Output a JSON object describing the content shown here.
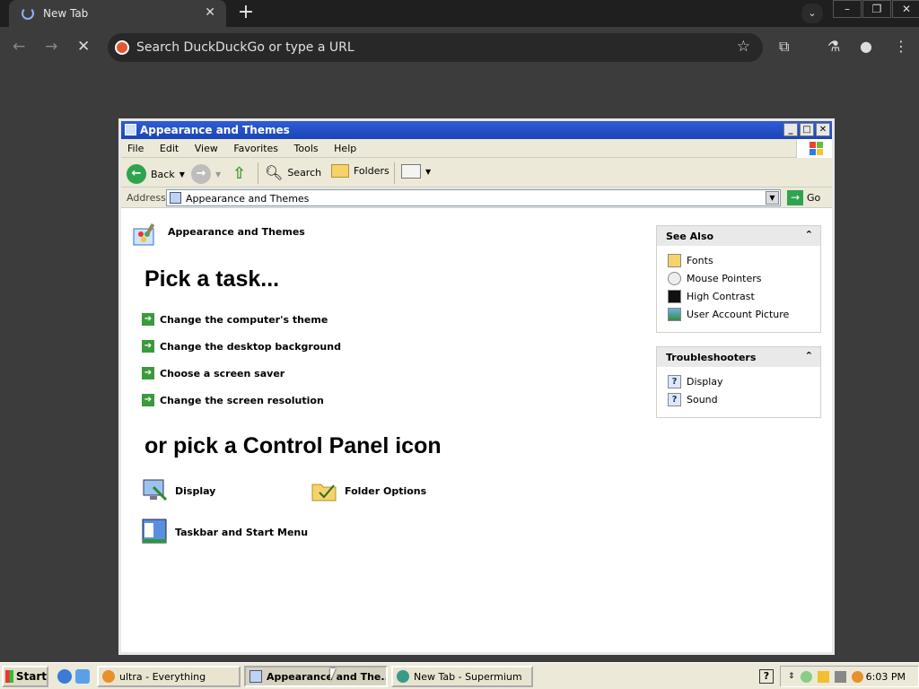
{
  "browser": {
    "tab_title": "New Tab",
    "omnibox_placeholder": "Search DuckDuckGo or type a URL"
  },
  "window": {
    "title": "Appearance and Themes",
    "menu": [
      "File",
      "Edit",
      "View",
      "Favorites",
      "Tools",
      "Help"
    ],
    "toolbar": {
      "back": "Back",
      "search": "Search",
      "folders": "Folders"
    },
    "address_label": "Address",
    "address_value": "Appearance and Themes",
    "go_label": "Go"
  },
  "content": {
    "header": "Appearance and Themes",
    "pick_task": "Pick a task...",
    "tasks": [
      "Change the computer's theme",
      "Change the desktop background",
      "Choose a screen saver",
      "Change the screen resolution"
    ],
    "or_pick": "or pick a Control Panel icon",
    "icons": [
      "Display",
      "Folder Options",
      "Taskbar and Start Menu"
    ]
  },
  "see_also": {
    "title": "See Also",
    "items": [
      "Fonts",
      "Mouse Pointers",
      "High Contrast",
      "User Account Picture"
    ]
  },
  "troubleshooters": {
    "title": "Troubleshooters",
    "items": [
      "Display",
      "Sound"
    ]
  },
  "taskbar": {
    "start": "Start",
    "tasks": [
      "ultra - Everything",
      "Appearance and The...",
      "New Tab - Supermium"
    ],
    "clock": "6:03 PM"
  },
  "colors": {
    "titlebar": "#1b45b8",
    "task_arrow": "#3b9a3b"
  }
}
